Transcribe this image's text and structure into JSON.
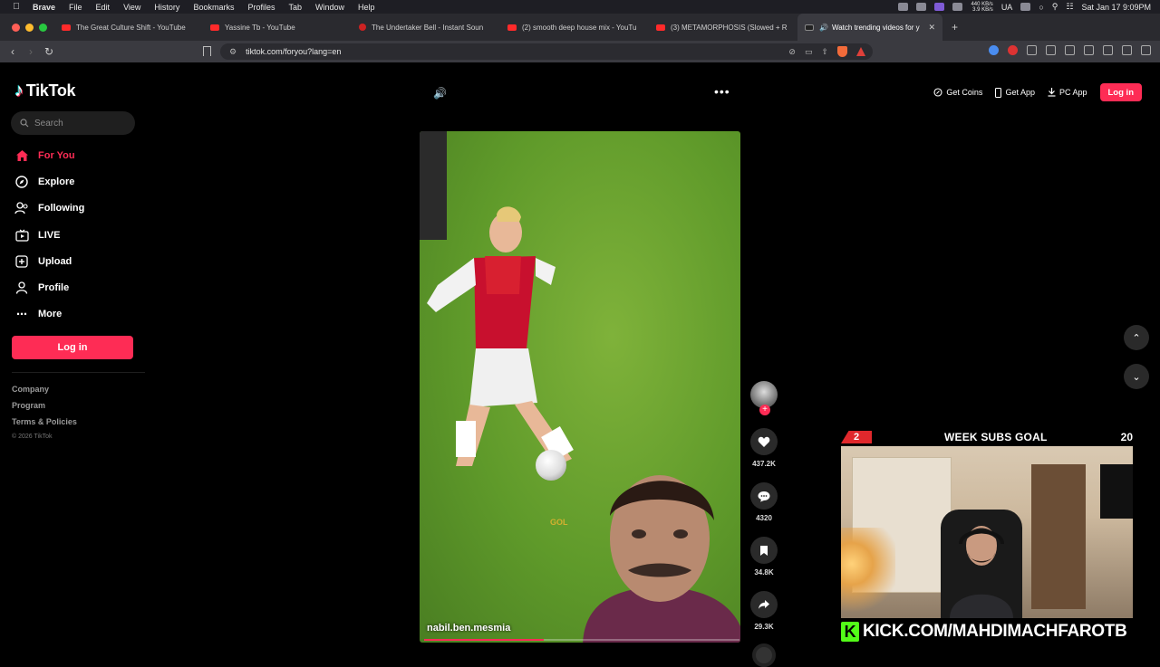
{
  "menubar": {
    "items": [
      "Brave",
      "File",
      "Edit",
      "View",
      "History",
      "Bookmarks",
      "Profiles",
      "Tab",
      "Window",
      "Help"
    ],
    "net_up": "440 KB/s",
    "net_down": "3.9 KB/s",
    "keyboard": "UA",
    "datetime": "Sat Jan 17  9:09PM"
  },
  "tabs": [
    {
      "title": "The Great Culture Shift - YouTube",
      "favicon": "youtube-icon"
    },
    {
      "title": "Yassine Tb - YouTube",
      "favicon": "youtube-icon"
    },
    {
      "title": "The Undertaker Bell - Instant Soun",
      "favicon": "sound-icon"
    },
    {
      "title": "(2) smooth deep house mix - YouTu",
      "favicon": "youtube-icon"
    },
    {
      "title": "(3) METAMORPHOSIS (Slowed + R",
      "favicon": "youtube-icon"
    },
    {
      "title": "Watch trending videos for y",
      "favicon": "tiktok-icon",
      "active": true
    }
  ],
  "address": {
    "url": "tiktok.com/foryou?lang=en",
    "shield_count": "4"
  },
  "tiktok": {
    "brand": "TikTok",
    "search_placeholder": "Search",
    "nav": [
      {
        "label": "For You",
        "icon": "home-icon",
        "active": true
      },
      {
        "label": "Explore",
        "icon": "compass-icon"
      },
      {
        "label": "Following",
        "icon": "following-icon"
      },
      {
        "label": "LIVE",
        "icon": "live-icon"
      },
      {
        "label": "Upload",
        "icon": "upload-icon"
      },
      {
        "label": "Profile",
        "icon": "profile-icon"
      },
      {
        "label": "More",
        "icon": "more-icon"
      }
    ],
    "login_label": "Log in",
    "footer": [
      "Company",
      "Program",
      "Terms & Policies"
    ],
    "copyright": "© 2026 TikTok",
    "top_actions": {
      "coins": "Get Coins",
      "app": "Get App",
      "pc_app": "PC App",
      "login": "Log in"
    },
    "video": {
      "author": "nabil.ben.mesmia",
      "overlay_text": "GOL",
      "progress": 0.38
    },
    "stats": {
      "likes": "437.2K",
      "comments": "4320",
      "saves": "34.8K",
      "shares": "29.3K"
    }
  },
  "stream": {
    "goal_current": "2",
    "goal_title": "WEEK SUBS GOAL",
    "goal_target": "20",
    "kick_url": "KICK.COM/MAHDIMACHFAROTB",
    "kick_logo": "K"
  },
  "colors": {
    "accent": "#fe2c55",
    "kick_green": "#53fc18",
    "goal_red": "#e0282c"
  }
}
